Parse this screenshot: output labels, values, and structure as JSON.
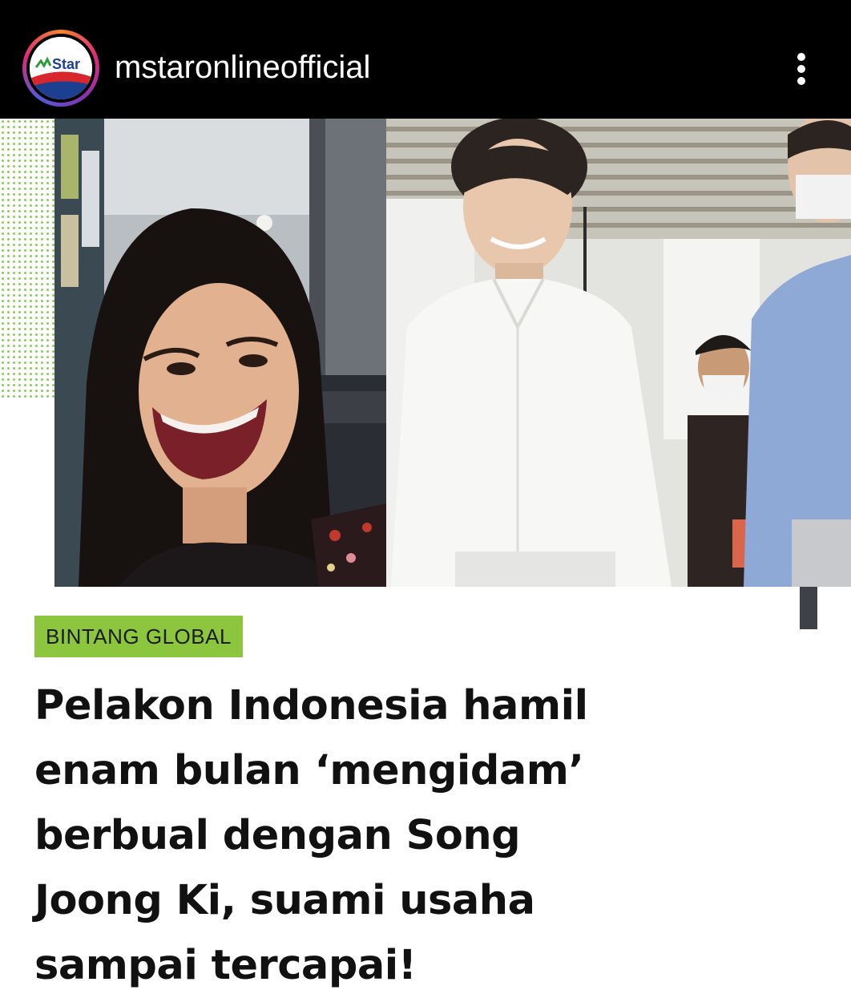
{
  "post_header": {
    "username": "mstaronlineofficial",
    "avatar_logo_text": "Star",
    "more_icon": "more-vertical-icon"
  },
  "article": {
    "category": "BINTANG GLOBAL",
    "headline_lines": [
      "Pelakon Indonesia hamil",
      "enam bulan ‘mengidam’",
      "berbual dengan Song",
      "Joong Ki, suami usaha",
      "sampai tercapai!"
    ]
  },
  "colors": {
    "header_bg": "#000000",
    "category_bg": "#8cc63f",
    "headline_text": "#111111",
    "dot_pattern": "#7cc243"
  }
}
